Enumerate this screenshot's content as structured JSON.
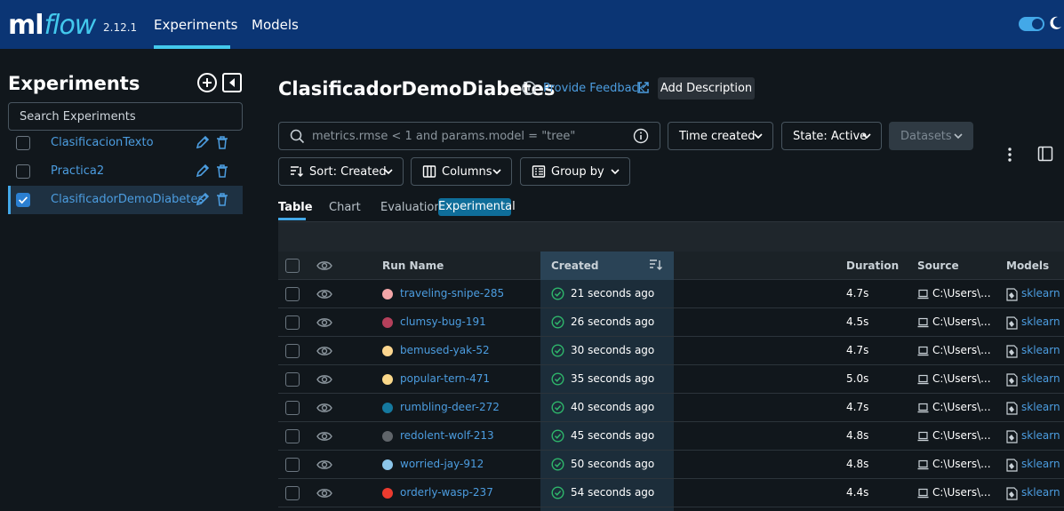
{
  "app": {
    "logo_ml": "ml",
    "logo_flow": "flow",
    "version": "2.12.1"
  },
  "nav": {
    "experiments": "Experiments",
    "models": "Models"
  },
  "sidebar": {
    "title": "Experiments",
    "search_placeholder": "Search Experiments",
    "items": [
      {
        "label": "ClasificacionTexto",
        "checked": false
      },
      {
        "label": "Practica2",
        "checked": false
      },
      {
        "label": "ClasificadorDemoDiabetes",
        "checked": true
      }
    ]
  },
  "experiment": {
    "title": "ClasificadorDemoDiabetes",
    "feedback": "Provide Feedback",
    "add_description": "Add Description"
  },
  "filters": {
    "search_placeholder": "metrics.rmse < 1 and params.model = \"tree\"",
    "time_created": "Time created",
    "state": "State: Active",
    "datasets": "Datasets",
    "sort": "Sort: Created",
    "columns": "Columns",
    "group_by": "Group by"
  },
  "view_tabs": {
    "table": "Table",
    "chart": "Chart",
    "evaluation": "Evaluation",
    "badge": "Experimental"
  },
  "table": {
    "headers": {
      "run_name": "Run Name",
      "created": "Created",
      "duration": "Duration",
      "source": "Source",
      "models": "Models"
    },
    "rows": [
      {
        "name": "traveling-snipe-285",
        "color": "#f4a6a8",
        "created": "21 seconds ago",
        "duration": "4.7s",
        "source": "C:\\Users\\...",
        "model": "sklearn"
      },
      {
        "name": "clumsy-bug-191",
        "color": "#b5405b",
        "created": "26 seconds ago",
        "duration": "4.5s",
        "source": "C:\\Users\\...",
        "model": "sklearn"
      },
      {
        "name": "bemused-yak-52",
        "color": "#fcd68f",
        "created": "30 seconds ago",
        "duration": "4.7s",
        "source": "C:\\Users\\...",
        "model": "sklearn"
      },
      {
        "name": "popular-tern-471",
        "color": "#fad88a",
        "created": "35 seconds ago",
        "duration": "5.0s",
        "source": "C:\\Users\\...",
        "model": "sklearn"
      },
      {
        "name": "rumbling-deer-272",
        "color": "#15799f",
        "created": "40 seconds ago",
        "duration": "4.7s",
        "source": "C:\\Users\\...",
        "model": "sklearn"
      },
      {
        "name": "redolent-wolf-213",
        "color": "#60656a",
        "created": "45 seconds ago",
        "duration": "4.8s",
        "source": "C:\\Users\\...",
        "model": "sklearn"
      },
      {
        "name": "worried-jay-912",
        "color": "#8cc6ea",
        "created": "50 seconds ago",
        "duration": "4.8s",
        "source": "C:\\Users\\...",
        "model": "sklearn"
      },
      {
        "name": "orderly-wasp-237",
        "color": "#ec3b2f",
        "created": "54 seconds ago",
        "duration": "4.4s",
        "source": "C:\\Users\\...",
        "model": "sklearn"
      }
    ]
  },
  "colors": {
    "topbar": "#0b3574",
    "accent": "#43c9ed",
    "link": "#4c9de0",
    "success": "#2fb66b"
  }
}
